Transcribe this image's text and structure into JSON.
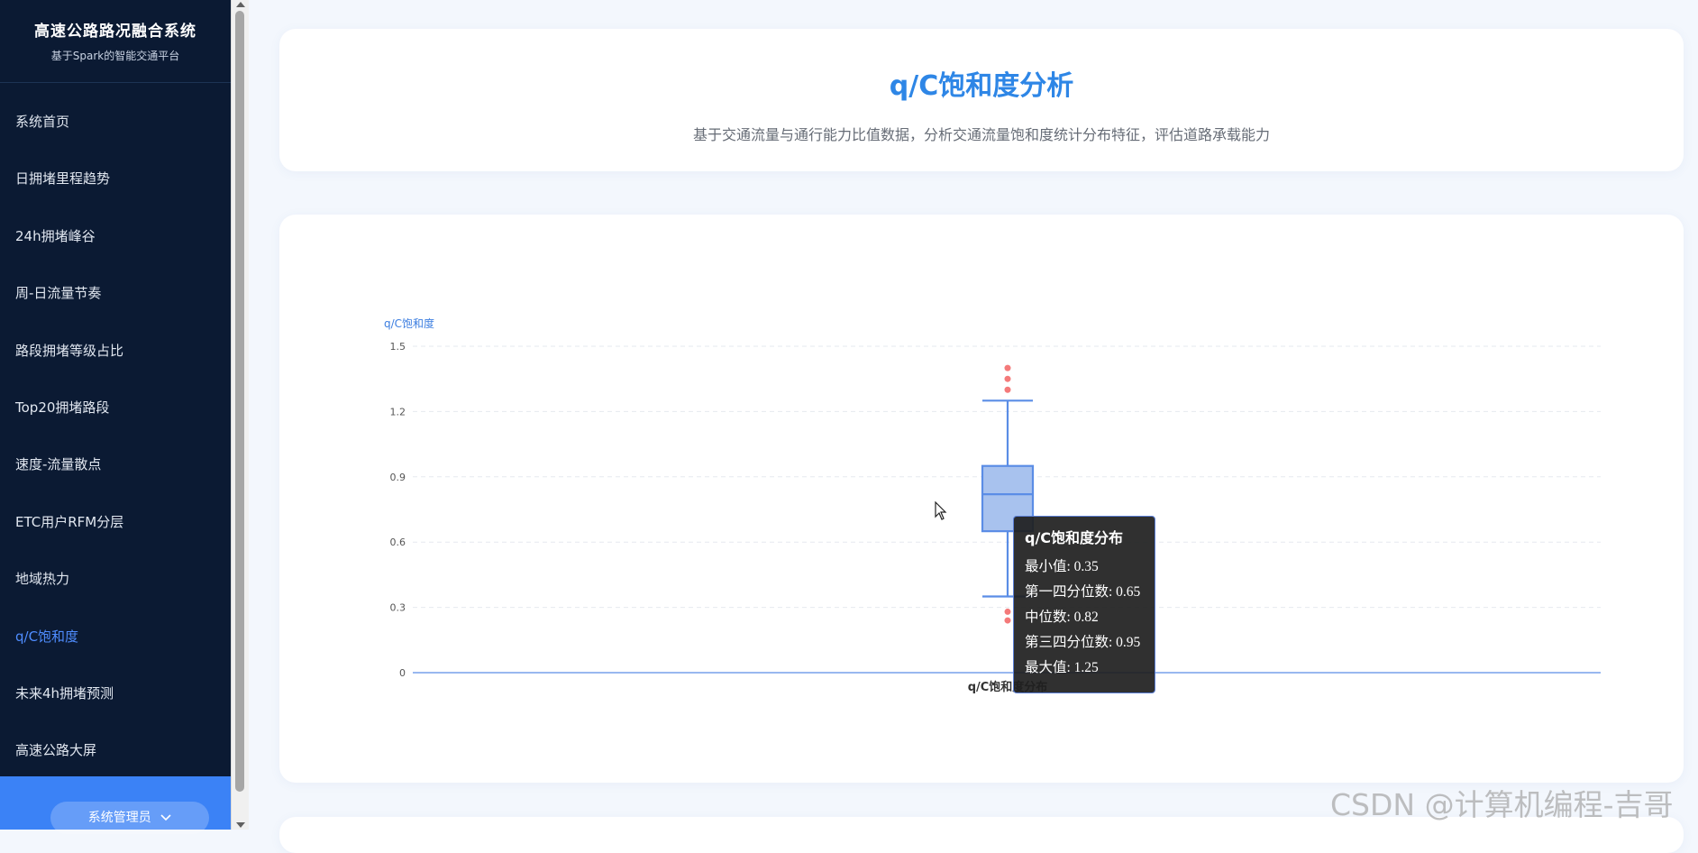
{
  "sidebar": {
    "title": "高速公路路况融合系统",
    "subtitle": "基于Spark的智能交通平台",
    "items": [
      {
        "label": "系统首页"
      },
      {
        "label": "日拥堵里程趋势"
      },
      {
        "label": "24h拥堵峰谷"
      },
      {
        "label": "周-日流量节奏"
      },
      {
        "label": "路段拥堵等级占比"
      },
      {
        "label": "Top20拥堵路段"
      },
      {
        "label": "速度-流量散点"
      },
      {
        "label": "ETC用户RFM分层"
      },
      {
        "label": "地域热力"
      },
      {
        "label": "q/C饱和度",
        "active": true
      },
      {
        "label": "未来4h拥堵预测"
      },
      {
        "label": "高速公路大屏"
      }
    ],
    "user_label": "系统管理员",
    "user_icon": "chevron-down-icon"
  },
  "header": {
    "title": "q/C饱和度分析",
    "description": "基于交通流量与通行能力比值数据，分析交通流量饱和度统计分布特征，评估道路承载能力"
  },
  "chart_data": {
    "type": "boxplot",
    "ylabel": "q/C饱和度",
    "ylim": [
      0,
      1.5
    ],
    "yticks": [
      "0",
      "0.3",
      "0.6",
      "0.9",
      "1.2",
      "1.5"
    ],
    "categories": [
      "q/C饱和度分布"
    ],
    "box": {
      "min": 0.35,
      "q1": 0.65,
      "median": 0.82,
      "q3": 0.95,
      "max": 1.25
    },
    "outliers": [
      1.3,
      1.35,
      1.4,
      0.28,
      0.24
    ],
    "grid": true,
    "colors": {
      "box_fill": "#a8c2ee",
      "box_stroke": "#5b8de6",
      "outlier": "#f47a7a",
      "axis": "#5b8de6"
    }
  },
  "tooltip": {
    "title": "q/C饱和度分布",
    "rows": [
      "最小值: 0.35",
      "第一四分位数: 0.65",
      "中位数: 0.82",
      "第三四分位数: 0.95",
      "最大值: 1.25"
    ]
  },
  "watermark": "CSDN @计算机编程-吉哥"
}
